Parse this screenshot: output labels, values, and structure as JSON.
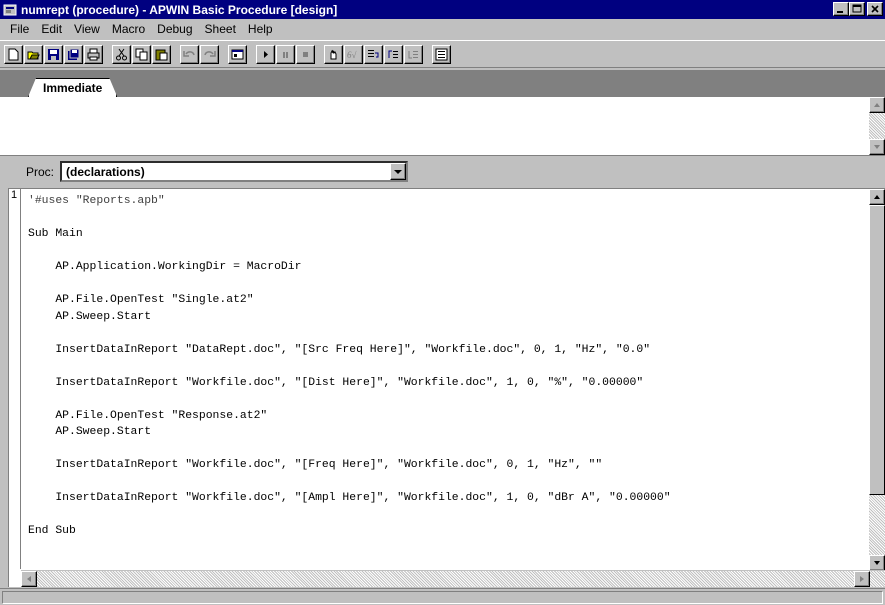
{
  "window": {
    "title": "numrept (procedure) - APWIN Basic Procedure [design]"
  },
  "menu": [
    {
      "label": "File"
    },
    {
      "label": "Edit"
    },
    {
      "label": "View"
    },
    {
      "label": "Macro"
    },
    {
      "label": "Debug"
    },
    {
      "label": "Sheet"
    },
    {
      "label": "Help"
    }
  ],
  "toolbar": {
    "buttons": [
      "new-icon",
      "open-icon",
      "save-icon",
      "save-all-icon",
      "print-icon",
      "cut-icon",
      "copy-icon",
      "paste-icon",
      "undo-icon",
      "redo-icon",
      "dialog-editor-icon",
      "run-icon",
      "pause-icon",
      "stop-icon",
      "toggle-breakpoint-icon",
      "quick-watch-icon",
      "step-into-icon",
      "step-over-icon",
      "step-out-icon",
      "procedure-list-icon"
    ]
  },
  "immediate": {
    "tab_label": "Immediate"
  },
  "proc": {
    "label": "Proc:",
    "value": "(declarations)"
  },
  "editor": {
    "line_number": "1",
    "lines": [
      "'#uses \"Reports.apb\"",
      "",
      "Sub Main",
      "",
      "    AP.Application.WorkingDir = MacroDir",
      "",
      "    AP.File.OpenTest \"Single.at2\"",
      "    AP.Sweep.Start",
      "",
      "    InsertDataInReport \"DataRept.doc\", \"[Src Freq Here]\", \"Workfile.doc\", 0, 1, \"Hz\", \"0.0\"",
      "",
      "    InsertDataInReport \"Workfile.doc\", \"[Dist Here]\", \"Workfile.doc\", 1, 0, \"%\", \"0.00000\"",
      "",
      "    AP.File.OpenTest \"Response.at2\"",
      "    AP.Sweep.Start",
      "",
      "    InsertDataInReport \"Workfile.doc\", \"[Freq Here]\", \"Workfile.doc\", 0, 1, \"Hz\", \"\"",
      "",
      "    InsertDataInReport \"Workfile.doc\", \"[Ampl Here]\", \"Workfile.doc\", 1, 0, \"dBr A\", \"0.00000\"",
      "",
      "End Sub"
    ]
  }
}
